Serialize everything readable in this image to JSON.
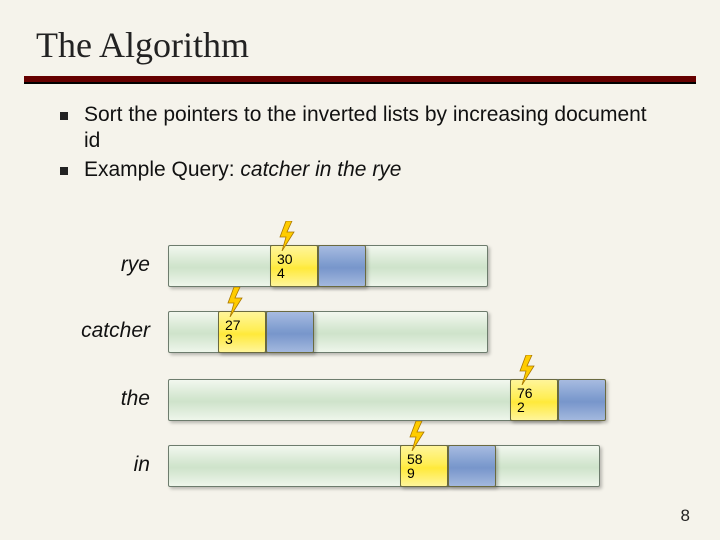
{
  "title": "The Algorithm",
  "bullets": [
    {
      "text": "Sort the pointers to the inverted lists by increasing document id"
    },
    {
      "prefix": "Example Query: ",
      "query": "catcher in the rye"
    }
  ],
  "rows": {
    "rye": {
      "label": "rye",
      "doc": "30",
      "cnt": "4"
    },
    "catcher": {
      "label": "catcher",
      "doc": "27",
      "cnt": "3"
    },
    "the": {
      "label": "the",
      "doc": "76",
      "cnt": "2"
    },
    "in": {
      "label": "in",
      "doc": "58",
      "cnt": "9"
    }
  },
  "page_number": "8",
  "colors": {
    "accent_rule": "#660000",
    "highlight_cell": "#ffee55",
    "normal_cell": "#7e9ccf",
    "bar_fill": "#d3e6cf",
    "bolt": "#ffcc00"
  }
}
